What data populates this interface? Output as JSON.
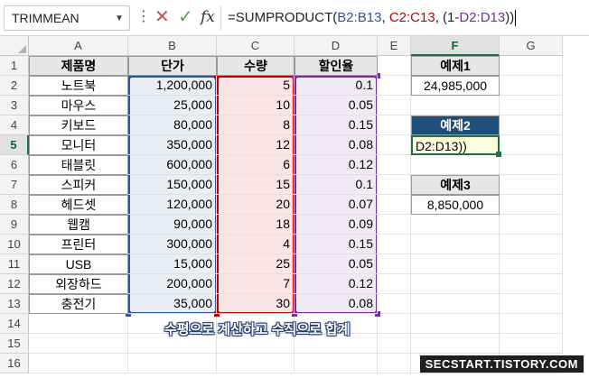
{
  "formula_bar": {
    "name_box": "TRIMMEAN",
    "formula_prefix": "=SUMPRODUCT(",
    "ref1": "B2:B13",
    "sep1": ", ",
    "ref2": "C2:C13",
    "sep2": ", (1-",
    "ref3": "D2:D13",
    "suffix": "))"
  },
  "columns": [
    "A",
    "B",
    "C",
    "D",
    "E",
    "F",
    "G"
  ],
  "rows": [
    "1",
    "2",
    "3",
    "4",
    "5",
    "6",
    "7",
    "8",
    "9",
    "10",
    "11",
    "12",
    "13",
    "14",
    "15",
    "16"
  ],
  "table": {
    "headers": [
      "제품명",
      "단가",
      "수량",
      "할인율"
    ],
    "rows": [
      [
        "노트북",
        "1,200,000",
        "5",
        "0.1"
      ],
      [
        "마우스",
        "25,000",
        "10",
        "0.05"
      ],
      [
        "키보드",
        "80,000",
        "8",
        "0.15"
      ],
      [
        "모니터",
        "350,000",
        "12",
        "0.08"
      ],
      [
        "태블릿",
        "600,000",
        "6",
        "0.12"
      ],
      [
        "스피커",
        "150,000",
        "15",
        "0.1"
      ],
      [
        "헤드셋",
        "120,000",
        "20",
        "0.07"
      ],
      [
        "웹캠",
        "90,000",
        "18",
        "0.09"
      ],
      [
        "프린터",
        "300,000",
        "4",
        "0.15"
      ],
      [
        "USB",
        "15,000",
        "25",
        "0.05"
      ],
      [
        "외장하드",
        "200,000",
        "7",
        "0.12"
      ],
      [
        "충전기",
        "35,000",
        "30",
        "0.08"
      ]
    ]
  },
  "examples": {
    "ex1_label": "예제1",
    "ex1_value": "24,985,000",
    "ex2_label": "예제2",
    "ex2_value": "D2:D13))",
    "ex3_label": "예제3",
    "ex3_value": "8,850,000"
  },
  "caption": "수평으로 계산하고 수직으로 합계",
  "watermark": "SECSTART.TISTORY.COM",
  "colors": {
    "ref_b": "#2f5597",
    "ref_c": "#c00000",
    "ref_d": "#7030a0",
    "active_cell": "#1e7145",
    "ex2_header": "#1f4e79"
  }
}
